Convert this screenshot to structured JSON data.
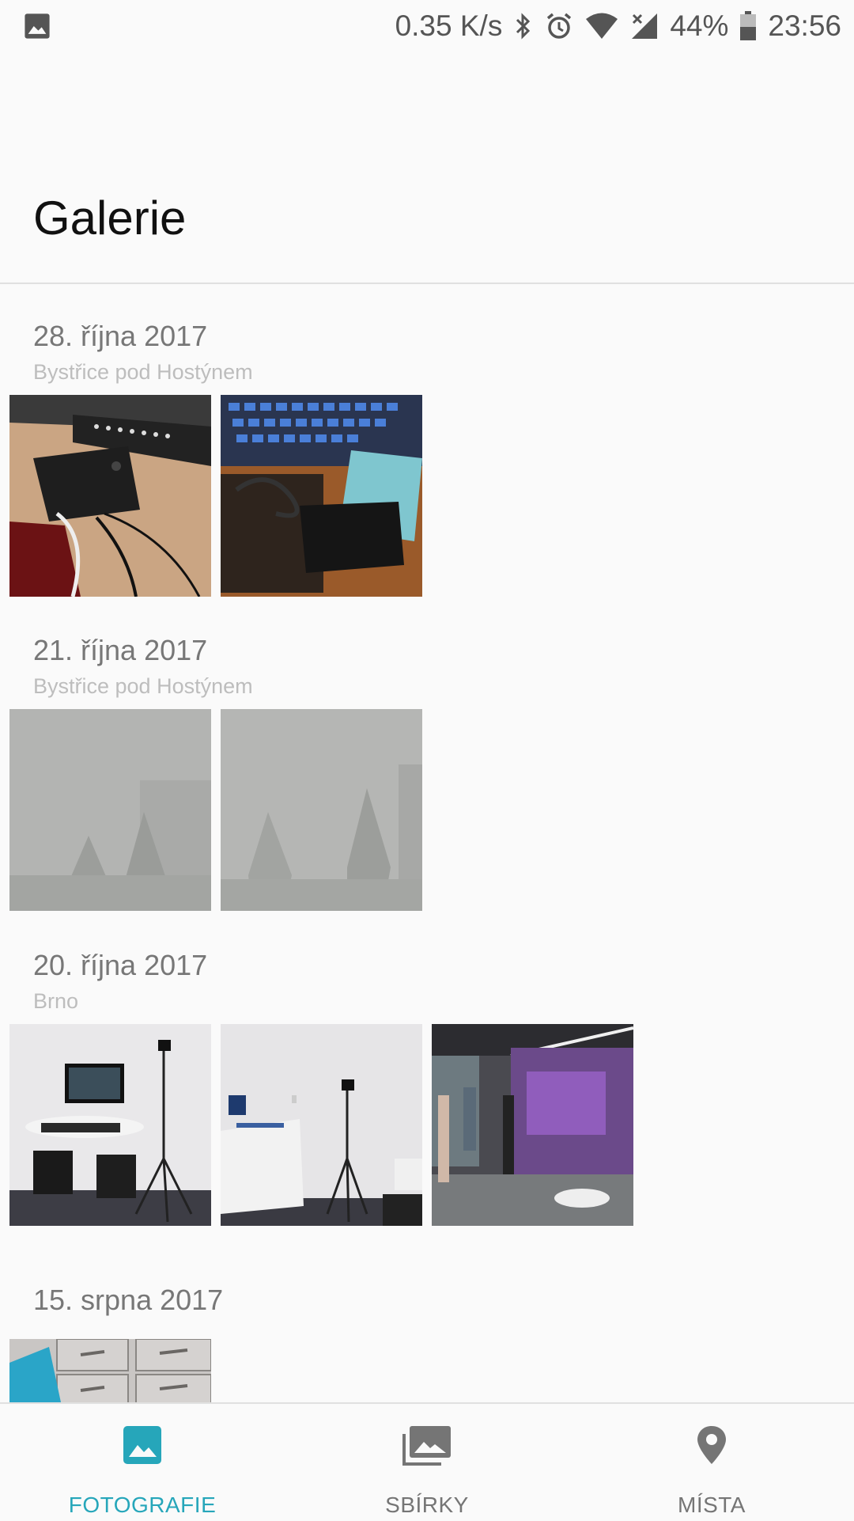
{
  "status_bar": {
    "speed": "0.35 K/s",
    "battery": "44%",
    "time": "23:56"
  },
  "header": {
    "title": "Galerie"
  },
  "sections": [
    {
      "date": "28. října 2017",
      "location": "Bystřice pod Hostýnem",
      "photos": [
        "photo-tv-box-remote",
        "photo-tv-box-keyboard"
      ]
    },
    {
      "date": "21. října 2017",
      "location": "Bystřice pod Hostýnem",
      "photos": [
        "photo-fog-1",
        "photo-fog-2"
      ]
    },
    {
      "date": "20. října 2017",
      "location": "Brno",
      "photos": [
        "photo-vr-setup",
        "photo-tripod-room",
        "photo-event-hall"
      ]
    },
    {
      "date": "15. srpna 2017",
      "location": "",
      "photos": [
        "photo-drawers"
      ]
    }
  ],
  "bottom_nav": {
    "items": [
      {
        "label": "FOTOGRAFIE",
        "icon": "photo-icon",
        "active": true
      },
      {
        "label": "SBÍRKY",
        "icon": "collections-icon",
        "active": false
      },
      {
        "label": "MÍSTA",
        "icon": "place-icon",
        "active": false
      }
    ]
  },
  "colors": {
    "accent": "#26a6ba",
    "background": "#fafafa"
  }
}
